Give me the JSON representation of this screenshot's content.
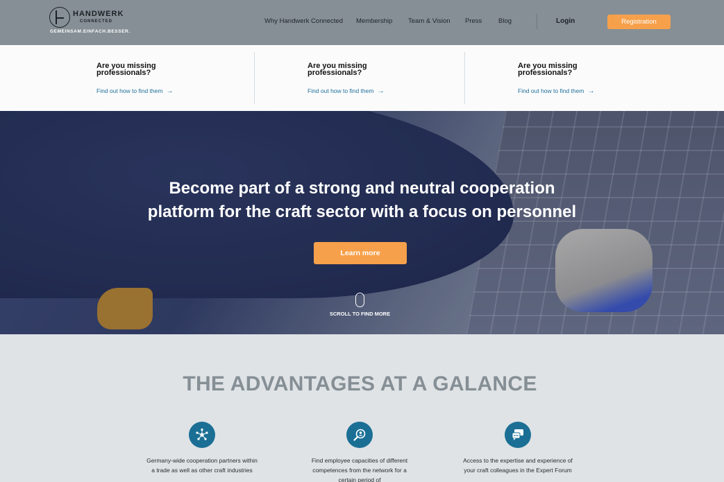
{
  "header": {
    "logo": {
      "name": "HANDWERK",
      "sub": "CONNECTED",
      "tagline": "GEMEINSAM.EINFACH.BESSER."
    },
    "nav": [
      "Why Handwerk Connected",
      "Membership",
      "Team & Vision",
      "Press",
      "Blog"
    ],
    "login": "Login",
    "registration": "Registration"
  },
  "strip": {
    "cards": [
      {
        "title": "Are you missing professionals?",
        "link": "Find out how to find them"
      },
      {
        "title": "Are you missing professionals?",
        "link": "Find out how to find them"
      },
      {
        "title": "Are you missing professionals?",
        "link": "Find out how to find them"
      }
    ]
  },
  "hero": {
    "title_line1": "Become part of a strong and neutral cooperation",
    "title_line2": "platform for the craft sector with a focus on personnel",
    "button": "Learn more",
    "scroll": "SCROLL TO FIND MORE"
  },
  "advantages": {
    "title": "THE ADVANTAGES AT A GALANCE",
    "items": [
      {
        "icon": "network-icon",
        "text": "Germany-wide cooperation partners within a trade as well as other craft industries"
      },
      {
        "icon": "search-person-icon",
        "text": "Find employee capacities of different competences from the network for a certain period of"
      },
      {
        "icon": "chat-icon",
        "text": "Access to the expertise and experience of your craft colleagues in the Expert Forum"
      }
    ]
  },
  "colors": {
    "accent": "#f7a04b",
    "header": "#858f95",
    "icon_bg": "#1b6f95",
    "link": "#1d6f98"
  }
}
